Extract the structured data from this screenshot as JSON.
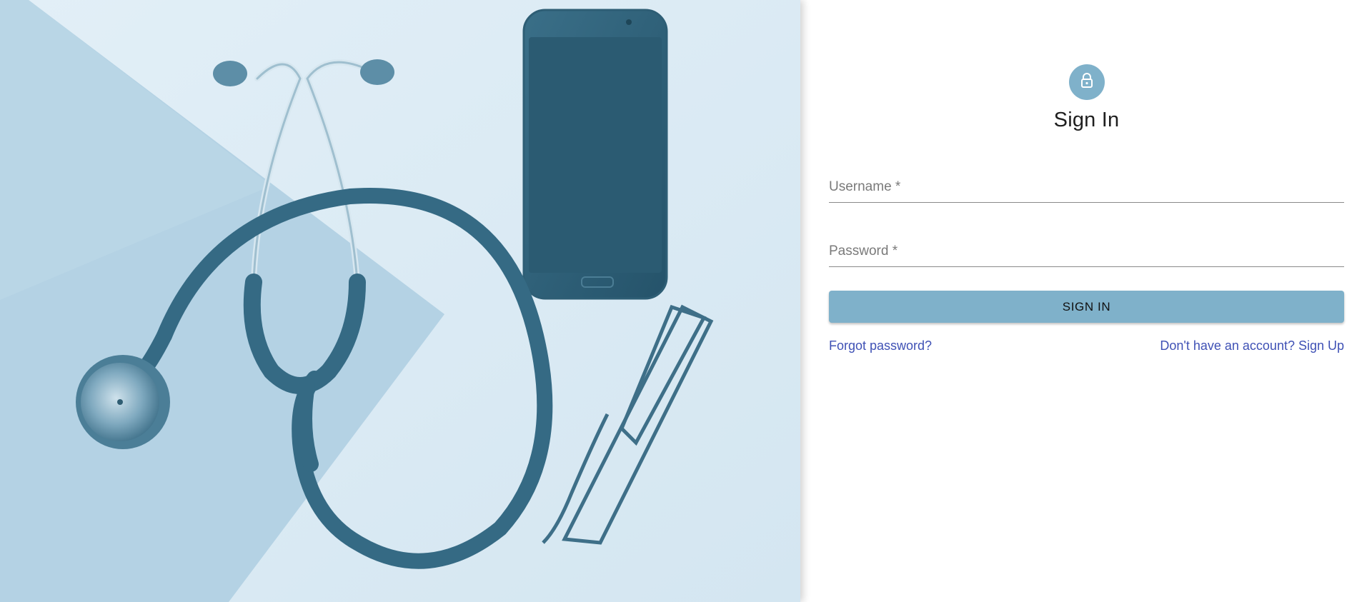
{
  "hero": {
    "image_description_icon": "stethoscope-phone-glasses-photo"
  },
  "signin": {
    "icon": "lock-icon",
    "title": "Sign In",
    "username_label": "Username *",
    "password_label": "Password *",
    "submit_label": "SIGN IN",
    "forgot_label": "Forgot password?",
    "signup_label": "Don't have an account? Sign Up"
  },
  "colors": {
    "accent": "#7fb1ca",
    "link": "#3f51b5",
    "hero_bg": "#dcebf4",
    "hero_dark": "#2d5e77"
  }
}
